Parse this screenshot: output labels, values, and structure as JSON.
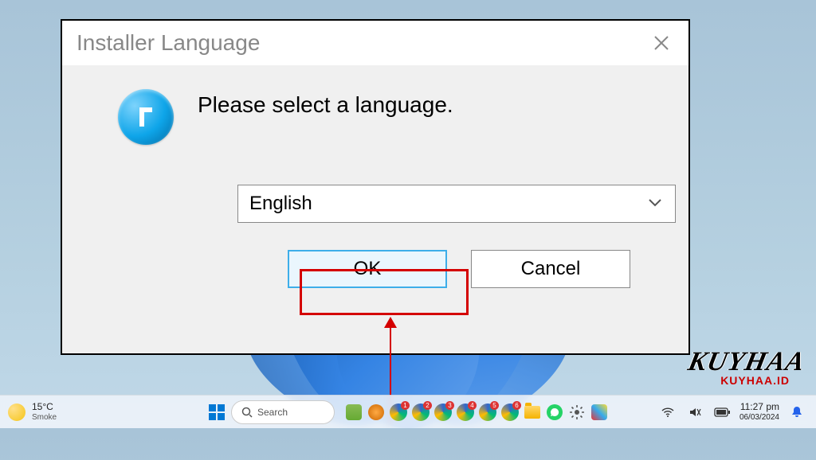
{
  "dialog": {
    "title": "Installer Language",
    "prompt": "Please select a language.",
    "selected_language": "English",
    "ok_label": "OK",
    "cancel_label": "Cancel"
  },
  "taskbar": {
    "weather": {
      "temp": "15°C",
      "condition": "Smoke"
    },
    "search_placeholder": "Search",
    "edge_badges": [
      "1",
      "2",
      "3",
      "4",
      "5",
      "6"
    ],
    "clock": {
      "time": "11:27 pm",
      "date": "06/03/2024"
    }
  },
  "watermark": {
    "line1": "KUYHAA",
    "line2": "KUYHAA.ID"
  }
}
